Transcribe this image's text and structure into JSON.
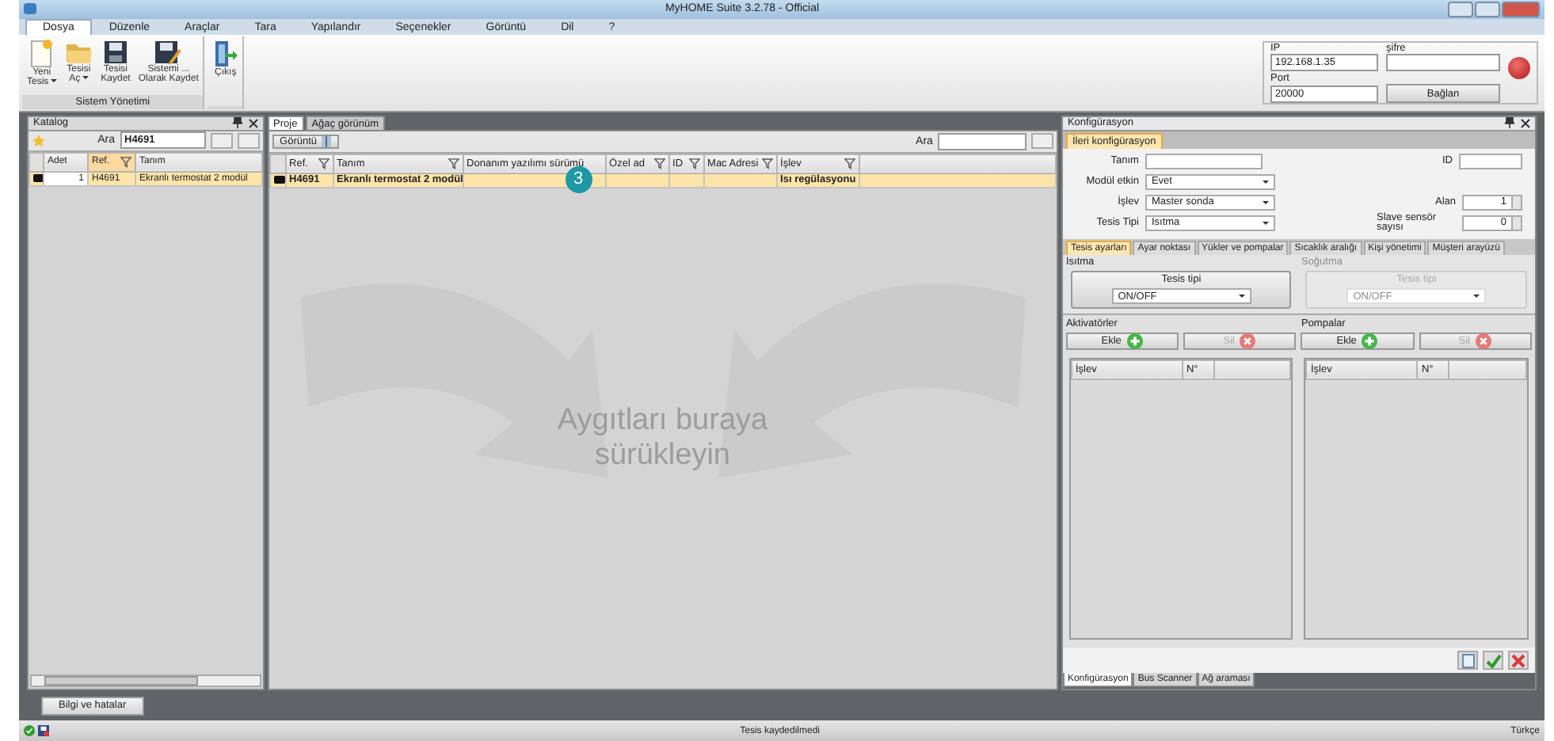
{
  "window": {
    "title": "MyHOME Suite 3.2.78 - Official"
  },
  "menu": [
    {
      "label": "Dosya",
      "selected": true
    },
    {
      "label": "Düzenle",
      "selected": false
    },
    {
      "label": "Araçlar",
      "selected": false
    },
    {
      "label": "Tara",
      "selected": false
    },
    {
      "label": "Yapılandır",
      "selected": false
    },
    {
      "label": "Seçenekler",
      "selected": false
    },
    {
      "label": "Görüntü",
      "selected": false
    },
    {
      "label": "Dil",
      "selected": false
    },
    {
      "label": "?",
      "selected": false
    }
  ],
  "ribbon": {
    "groups": [
      {
        "title": "Sistem Yönetimi",
        "buttons": [
          {
            "kind": "new",
            "lines": [
              "Yeni",
              "Tesis"
            ],
            "dropdown": true
          },
          {
            "kind": "open",
            "lines": [
              "Tesisi",
              "Aç"
            ],
            "dropdown": true
          },
          {
            "kind": "save",
            "lines": [
              "Tesisi",
              "Kaydet"
            ],
            "dropdown": false
          },
          {
            "kind": "saveas",
            "lines": [
              "Sistemi ...",
              "Olarak Kaydet"
            ],
            "dropdown": false
          }
        ]
      },
      {
        "buttons": [
          {
            "kind": "exit",
            "lines": [
              "Çıkış"
            ],
            "dropdown": false
          }
        ]
      }
    ]
  },
  "connection": {
    "ip_label": "IP",
    "ip": "192.168.1.35",
    "password_label": "şifre",
    "port_label": "Port",
    "port": "20000",
    "connect_button": "Bağlan",
    "connected": false
  },
  "catalog": {
    "title": "Katalog",
    "search_label": "Ara",
    "search": "H4691",
    "columns": [
      {
        "label": "Adet",
        "sorted": false,
        "filter": false
      },
      {
        "label": "Ref.",
        "sorted": true,
        "filter": true
      },
      {
        "label": "Tanım",
        "sorted": false,
        "filter": false
      }
    ],
    "rows": [
      {
        "cells": [
          "1",
          "H4691",
          "Ekranlı termostat 2 modül"
        ],
        "selected": true
      }
    ]
  },
  "project": {
    "tabs": [
      {
        "label": "Proje",
        "selected": true
      },
      {
        "label": "Ağaç görünüm",
        "selected": false
      }
    ],
    "view_button": "Görüntü",
    "search_label": "Ara",
    "columns": [
      {
        "label": "Ref.",
        "filter": true
      },
      {
        "label": "Tanım",
        "filter": true
      },
      {
        "label": "Donanım yazılımı sürümü",
        "filter": false
      },
      {
        "label": "Özel ad",
        "filter": true
      },
      {
        "label": "ID",
        "filter": true
      },
      {
        "label": "Mac Adresi",
        "filter": true
      },
      {
        "label": "İşlev",
        "filter": true
      }
    ],
    "rows": [
      {
        "cells": [
          "H4691",
          "Ekranlı termostat 2 modül",
          "",
          "",
          "",
          "",
          "Isı regülasyonu"
        ],
        "selected": true
      }
    ],
    "drop_hint": "Aygıtları buraya sürükleyin",
    "callout": "3"
  },
  "config": {
    "title": "Konfigürasyon",
    "tabs": [
      {
        "label": "İleri konfigürasyon",
        "selected": true
      }
    ],
    "rows": [
      [
        {
          "label": "Tanım",
          "kind": "text"
        },
        {
          "label": "ID",
          "kind": "text"
        }
      ],
      [
        {
          "label": "Modül etkin",
          "kind": "select",
          "value": "Evet"
        }
      ],
      [
        {
          "label": "İşlev",
          "kind": "select",
          "value": "Master sonda"
        },
        {
          "label": "Alan",
          "kind": "spin",
          "value": "1"
        }
      ],
      [
        {
          "label": "Tesis Tipi",
          "kind": "select",
          "value": "Isıtma"
        },
        {
          "label": "Slave sensör sayısı",
          "kind": "spin",
          "value": "0"
        }
      ]
    ],
    "subtabs": [
      {
        "label": "Tesis ayarları",
        "selected": true
      },
      {
        "label": "Ayar noktası",
        "selected": false
      },
      {
        "label": "Yükler ve pompalar",
        "selected": false
      },
      {
        "label": "Sıcaklık aralığı",
        "selected": false
      },
      {
        "label": "Kişi yönetimi",
        "selected": false
      },
      {
        "label": "Müşteri arayüzü",
        "selected": false
      }
    ],
    "modes": [
      {
        "title": "Isıtma",
        "disabled": false,
        "button": "Tesis tipi",
        "value": "ON/OFF"
      },
      {
        "title": "Soğutma",
        "disabled": true,
        "button": "Tesis tipi",
        "value": "ON/OFF"
      }
    ],
    "lists": [
      {
        "title": "Aktivatörler",
        "add": "Ekle",
        "remove": "Sil",
        "remove_disabled": true,
        "columns": [
          "İşlev",
          "N°"
        ]
      },
      {
        "title": "Pompalar",
        "add": "Ekle",
        "remove": "Sil",
        "remove_disabled": true,
        "columns": [
          "İşlev",
          "N°"
        ]
      }
    ],
    "bottom_tabs": [
      {
        "label": "Konfigürasyon",
        "selected": true
      },
      {
        "label": "Bus Scanner",
        "selected": false
      },
      {
        "label": "Ağ araması",
        "selected": false
      }
    ]
  },
  "info_button": "Bilgi ve hatalar",
  "status_bar": {
    "message": "Tesis kaydedilmedi",
    "language": "Türkçe"
  }
}
